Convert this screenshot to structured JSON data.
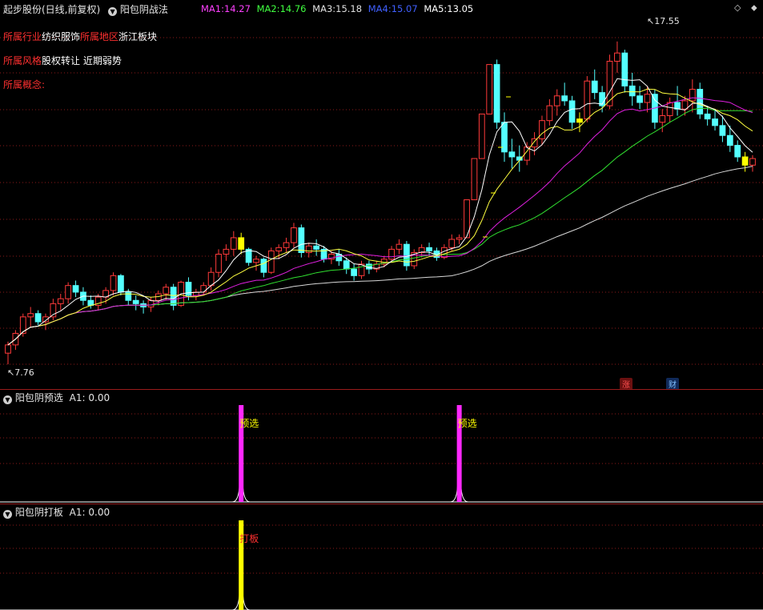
{
  "header": {
    "stock": "起步股份(日线,前复权)",
    "indicator": "阳包阴战法",
    "ma": [
      {
        "label": "MA1:",
        "value": "14.27",
        "color": "#ff40ff"
      },
      {
        "label": "MA2:",
        "value": "14.76",
        "color": "#40ff40"
      },
      {
        "label": "MA3:",
        "value": "15.18",
        "color": "#e0e0e0"
      },
      {
        "label": "MA4:",
        "value": "15.07",
        "color": "#4060ff"
      },
      {
        "label": "MA5:",
        "value": "13.05",
        "color": "#ffffff"
      }
    ]
  },
  "info": {
    "industry_key": "所属行业",
    "industry_val": "纺织服饰",
    "region_key": "所属地区",
    "region_val": "浙江板块",
    "style_key": "所属风格",
    "style_val": "股权转让 近期弱势",
    "concept_key": "所属概念:"
  },
  "price_labels": {
    "high": "17.55",
    "low": "7.76"
  },
  "markers": {
    "rise": "涨",
    "finance": "财"
  },
  "sub1": {
    "title": "阳包阴预选",
    "a1": "A1: 0.00",
    "signal": "预选"
  },
  "sub2": {
    "title": "阳包阴打板",
    "a1": "A1: 0.00",
    "signal": "打板"
  },
  "colors": {
    "up": "#ff3a3a",
    "down": "#54ffff",
    "yellow": "#ffff00",
    "magenta": "#ff28ff",
    "grid": "#8c1a1a"
  },
  "chart_data": {
    "type": "candlestick",
    "y_range": [
      7.4,
      18.2
    ],
    "y_max_label": 17.55,
    "y_min_label": 7.76,
    "candles": [
      [
        8.1,
        8.45,
        7.76,
        8.35
      ],
      [
        8.35,
        8.8,
        8.2,
        8.7
      ],
      [
        8.7,
        9.3,
        8.6,
        9.2
      ],
      [
        9.2,
        9.5,
        8.9,
        9.3
      ],
      [
        9.3,
        9.4,
        8.95,
        9.05
      ],
      [
        9.05,
        9.3,
        8.8,
        9.2
      ],
      [
        9.2,
        9.75,
        9.1,
        9.6
      ],
      [
        9.6,
        9.9,
        9.4,
        9.75
      ],
      [
        9.75,
        10.25,
        9.6,
        10.15
      ],
      [
        10.15,
        10.3,
        9.8,
        9.95
      ],
      [
        9.95,
        10.1,
        9.55,
        9.7
      ],
      [
        9.7,
        9.85,
        9.45,
        9.55
      ],
      [
        9.55,
        9.9,
        9.4,
        9.8
      ],
      [
        9.8,
        10.1,
        9.6,
        10.0
      ],
      [
        10.0,
        10.55,
        9.85,
        10.45
      ],
      [
        10.45,
        10.5,
        9.85,
        9.95
      ],
      [
        9.95,
        10.05,
        9.55,
        9.7
      ],
      [
        9.7,
        9.85,
        9.4,
        9.6
      ],
      [
        9.6,
        9.7,
        9.3,
        9.5
      ],
      [
        9.5,
        9.8,
        9.35,
        9.7
      ],
      [
        9.7,
        10.0,
        9.55,
        9.9
      ],
      [
        9.9,
        10.2,
        9.7,
        10.1
      ],
      [
        10.1,
        10.2,
        9.4,
        9.55
      ],
      [
        9.55,
        10.3,
        9.5,
        10.25
      ],
      [
        10.25,
        10.4,
        9.7,
        9.85
      ],
      [
        9.85,
        10.05,
        9.7,
        9.95
      ],
      [
        9.95,
        10.25,
        9.85,
        10.15
      ],
      [
        10.15,
        10.7,
        10.0,
        10.55
      ],
      [
        10.55,
        11.25,
        10.4,
        11.1
      ],
      [
        11.1,
        11.4,
        10.9,
        11.25
      ],
      [
        11.25,
        11.8,
        11.05,
        11.6
      ],
      [
        11.6,
        11.75,
        11.1,
        11.25
      ],
      [
        11.25,
        11.3,
        10.75,
        10.85
      ],
      [
        10.85,
        11.05,
        10.6,
        10.95
      ],
      [
        10.95,
        11.0,
        10.4,
        10.55
      ],
      [
        10.55,
        11.3,
        10.5,
        11.2
      ],
      [
        11.2,
        11.4,
        10.95,
        11.3
      ],
      [
        11.3,
        11.6,
        11.15,
        11.45
      ],
      [
        11.45,
        12.05,
        11.3,
        11.9
      ],
      [
        11.9,
        12.0,
        11.0,
        11.15
      ],
      [
        11.15,
        11.45,
        11.0,
        11.35
      ],
      [
        11.35,
        11.55,
        11.05,
        11.25
      ],
      [
        11.25,
        11.35,
        10.85,
        10.95
      ],
      [
        10.95,
        11.2,
        10.8,
        11.1
      ],
      [
        11.1,
        11.25,
        10.75,
        10.9
      ],
      [
        10.9,
        11.0,
        10.5,
        10.65
      ],
      [
        10.65,
        10.8,
        10.3,
        10.45
      ],
      [
        10.45,
        10.9,
        10.35,
        10.8
      ],
      [
        10.8,
        10.9,
        10.5,
        10.65
      ],
      [
        10.65,
        10.9,
        10.55,
        10.8
      ],
      [
        10.8,
        11.05,
        10.7,
        10.95
      ],
      [
        10.95,
        11.35,
        10.85,
        11.25
      ],
      [
        11.25,
        11.55,
        11.1,
        11.4
      ],
      [
        11.4,
        11.5,
        10.6,
        10.75
      ],
      [
        10.75,
        11.25,
        10.65,
        11.15
      ],
      [
        11.15,
        11.4,
        11.0,
        11.3
      ],
      [
        11.3,
        11.45,
        11.05,
        11.2
      ],
      [
        11.2,
        11.3,
        10.9,
        11.0
      ],
      [
        11.0,
        11.4,
        10.95,
        11.3
      ],
      [
        11.3,
        11.7,
        11.2,
        11.55
      ],
      [
        11.55,
        11.7,
        11.4,
        11.6
      ],
      [
        11.6,
        12.75,
        11.6,
        12.75
      ],
      [
        12.75,
        14.0,
        12.75,
        14.0
      ],
      [
        14.0,
        15.35,
        14.0,
        15.35
      ],
      [
        15.35,
        16.85,
        15.35,
        16.85
      ],
      [
        16.85,
        17.0,
        14.9,
        15.1
      ],
      [
        15.1,
        15.4,
        13.9,
        14.2
      ],
      [
        14.2,
        14.6,
        13.7,
        14.05
      ],
      [
        14.05,
        14.4,
        13.6,
        13.95
      ],
      [
        13.95,
        14.5,
        13.8,
        14.35
      ],
      [
        14.35,
        14.8,
        14.1,
        14.6
      ],
      [
        14.6,
        15.3,
        14.4,
        15.15
      ],
      [
        15.15,
        15.8,
        15.0,
        15.6
      ],
      [
        15.6,
        16.1,
        15.3,
        15.9
      ],
      [
        15.9,
        16.3,
        15.6,
        15.75
      ],
      [
        15.75,
        15.9,
        14.9,
        15.1
      ],
      [
        15.1,
        15.4,
        14.8,
        15.2
      ],
      [
        15.2,
        16.5,
        15.1,
        16.35
      ],
      [
        16.35,
        16.7,
        15.8,
        16.0
      ],
      [
        16.0,
        16.2,
        15.4,
        15.6
      ],
      [
        15.6,
        17.15,
        15.5,
        16.95
      ],
      [
        16.95,
        17.55,
        16.6,
        17.2
      ],
      [
        17.2,
        17.3,
        16.0,
        16.2
      ],
      [
        16.2,
        16.6,
        15.6,
        15.9
      ],
      [
        15.9,
        16.2,
        15.5,
        15.7
      ],
      [
        15.7,
        16.2,
        15.4,
        15.95
      ],
      [
        15.95,
        16.1,
        14.9,
        15.1
      ],
      [
        15.1,
        15.5,
        14.8,
        15.3
      ],
      [
        15.3,
        15.85,
        15.1,
        15.7
      ],
      [
        15.7,
        16.2,
        15.3,
        15.5
      ],
      [
        15.5,
        15.9,
        15.3,
        15.75
      ],
      [
        15.75,
        16.4,
        15.4,
        16.1
      ],
      [
        16.1,
        16.3,
        15.2,
        15.35
      ],
      [
        15.35,
        15.6,
        15.0,
        15.2
      ],
      [
        15.2,
        15.5,
        14.85,
        15.0
      ],
      [
        15.0,
        15.3,
        14.5,
        14.7
      ],
      [
        14.7,
        15.0,
        14.2,
        14.4
      ],
      [
        14.4,
        14.55,
        13.9,
        14.05
      ],
      [
        14.05,
        14.2,
        13.6,
        13.8
      ],
      [
        13.8,
        14.1,
        13.6,
        14.0
      ]
    ],
    "limit_up_candles": [
      31,
      76,
      98
    ],
    "preselect_signals": [
      31,
      60
    ],
    "daban_signals": [
      31
    ]
  }
}
